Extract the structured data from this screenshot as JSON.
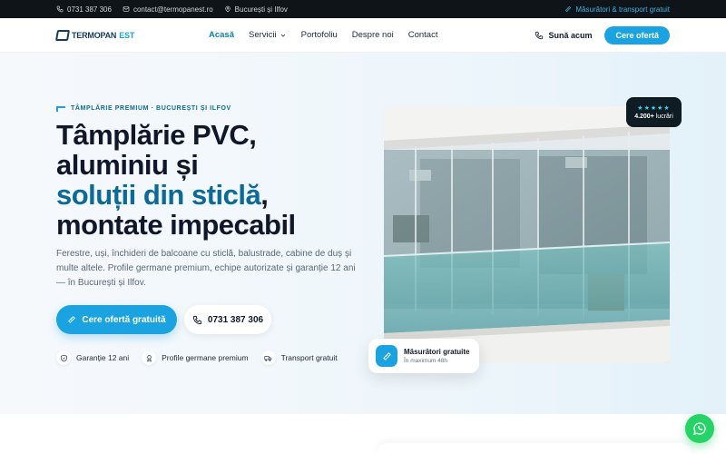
{
  "topbar": {
    "phone": "0731 387 306",
    "email": "contact@termopanest.ro",
    "location": "București și Ilfov",
    "promo": "Măsurători & transport gratuit"
  },
  "header": {
    "logo_main": "TERMOPAN",
    "logo_accent": "EST",
    "nav": [
      {
        "label": "Acasă",
        "active": true
      },
      {
        "label": "Servicii",
        "dropdown": true
      },
      {
        "label": "Portofoliu"
      },
      {
        "label": "Despre noi"
      },
      {
        "label": "Contact"
      }
    ],
    "call_label": "Sună acum",
    "cta_label": "Cere ofertă"
  },
  "hero": {
    "eyebrow": "TÂMPLĂRIE PREMIUM · BUCUREȘTI ȘI ILFOV",
    "title_line1": "Tâmplărie PVC,",
    "title_line2": "aluminiu și",
    "title_highlight": "soluții din sticlă",
    "title_comma": ",",
    "title_line4": "montate impecabil",
    "description": "Ferestre, uși, închideri de balcoane cu sticlă, balustrade, cabine de duș și multe altele. Profile germane premium, echipe autorizate și garanție 12 ani — în București și Ilfov.",
    "primary_cta": "Cere ofertă gratuită",
    "phone_cta": "0731 387 306",
    "badges": [
      {
        "icon": "shield-icon",
        "label": "Garanție 12 ani"
      },
      {
        "icon": "award-icon",
        "label": "Profile germane premium"
      },
      {
        "icon": "truck-icon",
        "label": "Transport gratuit"
      }
    ]
  },
  "rating": {
    "stars": "★★★★★",
    "count": "4.200+",
    "count_label": "lucrări"
  },
  "measure_card": {
    "title": "Măsurători gratuite",
    "subtitle": "În maximum 48h"
  },
  "colors": {
    "accent": "#1aa3e0",
    "dark": "#0f1419",
    "heading_blue": "#0b6a97",
    "whatsapp": "#25d366"
  }
}
